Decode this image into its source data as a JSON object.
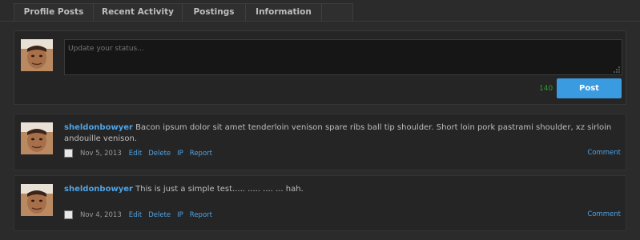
{
  "tabs": [
    {
      "label": "Profile Posts"
    },
    {
      "label": "Recent Activity"
    },
    {
      "label": "Postings"
    },
    {
      "label": "Information"
    }
  ],
  "status": {
    "placeholder": "Update your status...",
    "char_count": "140",
    "post_label": "Post"
  },
  "posts": [
    {
      "author": "sheldonbowyer",
      "text": "Bacon ipsum dolor sit amet tenderloin venison spare ribs ball tip shoulder. Short loin pork pastrami shoulder, xz sirloin andouille venison.",
      "date": "Nov 5, 2013",
      "actions": [
        "Edit",
        "Delete",
        "IP",
        "Report"
      ],
      "comment": "Comment"
    },
    {
      "author": "sheldonbowyer",
      "text": "This is just a simple test..... ..... .... ... hah.",
      "date": "Nov 4, 2013",
      "actions": [
        "Edit",
        "Delete",
        "IP",
        "Report"
      ],
      "comment": "Comment"
    }
  ],
  "icons": {
    "avatar": "user-avatar",
    "grip": "resize-grip-icon"
  },
  "colors": {
    "accent": "#3a9be0",
    "link": "#4ea3e6",
    "counter": "#2e9a2e"
  }
}
